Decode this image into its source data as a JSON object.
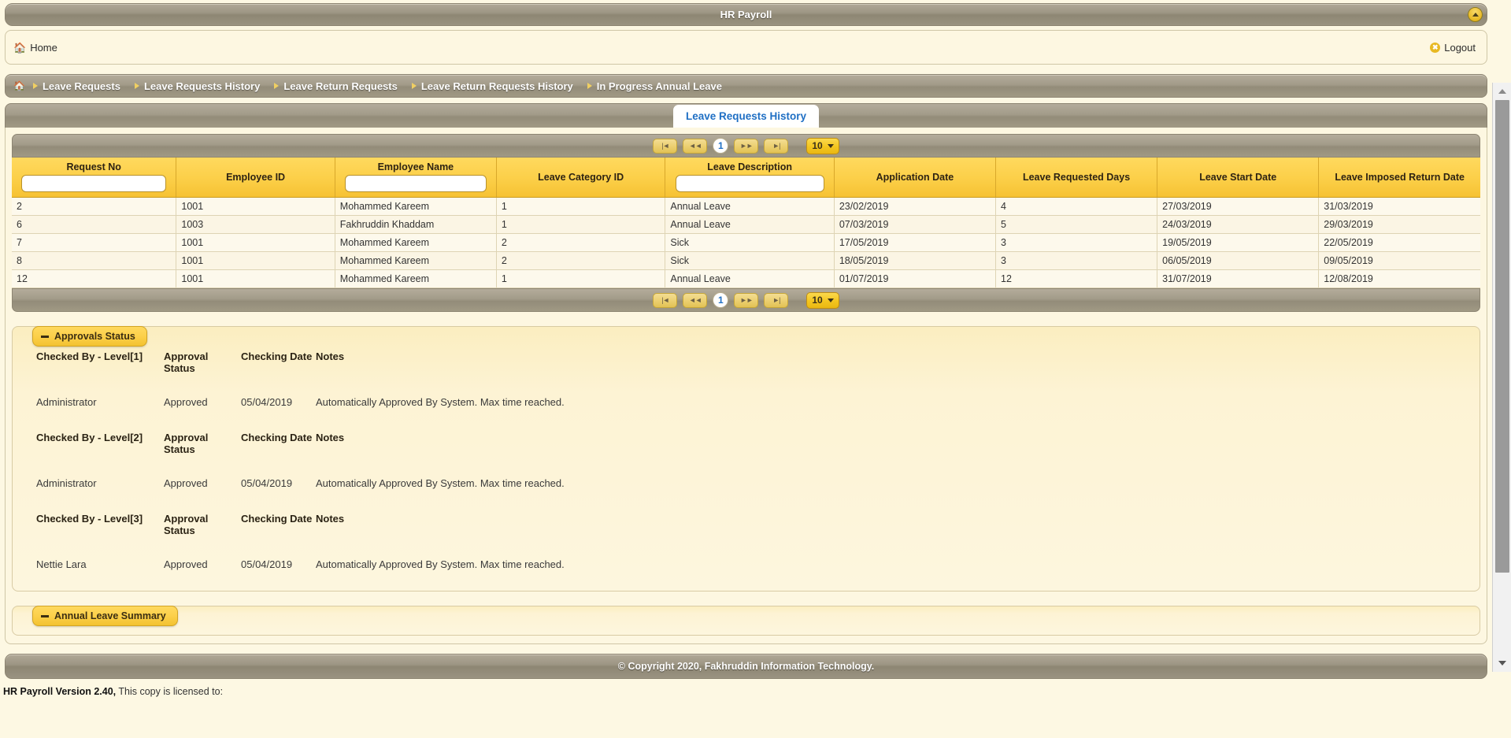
{
  "app": {
    "title": "HR Payroll",
    "collapse_icon": "collapse-up-icon"
  },
  "userbar": {
    "home_label": "Home",
    "home_icon": "home-icon",
    "logout_label": "Logout",
    "logout_icon": "close-circle-icon"
  },
  "menu": {
    "home_icon": "home-icon",
    "items": [
      {
        "label": "Leave Requests"
      },
      {
        "label": "Leave Requests History"
      },
      {
        "label": "Leave Return Requests"
      },
      {
        "label": "Leave Return Requests History"
      },
      {
        "label": "In Progress Annual Leave"
      }
    ]
  },
  "tabs": {
    "active": "Leave Requests History"
  },
  "pagination": {
    "first_icon": "first-page-icon",
    "prev_icon": "previous-page-icon",
    "next_icon": "next-page-icon",
    "last_icon": "last-page-icon",
    "first_label": "|◄",
    "prev_label": "◄◄",
    "next_label": "►►",
    "last_label": "►|",
    "current_page": "1",
    "page_size": "10"
  },
  "grid": {
    "columns": [
      {
        "label": "Request No",
        "filter": true,
        "value": ""
      },
      {
        "label": "Employee ID",
        "filter": false,
        "value": ""
      },
      {
        "label": "Employee Name",
        "filter": true,
        "value": ""
      },
      {
        "label": "Leave Category ID",
        "filter": false,
        "value": ""
      },
      {
        "label": "Leave Description",
        "filter": true,
        "value": ""
      },
      {
        "label": "Application Date",
        "filter": false,
        "value": ""
      },
      {
        "label": "Leave Requested Days",
        "filter": false,
        "value": ""
      },
      {
        "label": "Leave Start Date",
        "filter": false,
        "value": ""
      },
      {
        "label": "Leave Imposed Return Date",
        "filter": false,
        "value": ""
      }
    ],
    "rows": [
      [
        "2",
        "1001",
        "Mohammed Kareem",
        "1",
        "Annual Leave",
        "23/02/2019",
        "4",
        "27/03/2019",
        "31/03/2019"
      ],
      [
        "6",
        "1003",
        "Fakhruddin Khaddam",
        "1",
        "Annual Leave",
        "07/03/2019",
        "5",
        "24/03/2019",
        "29/03/2019"
      ],
      [
        "7",
        "1001",
        "Mohammed Kareem",
        "2",
        "Sick",
        "17/05/2019",
        "3",
        "19/05/2019",
        "22/05/2019"
      ],
      [
        "8",
        "1001",
        "Mohammed Kareem",
        "2",
        "Sick",
        "18/05/2019",
        "3",
        "06/05/2019",
        "09/05/2019"
      ],
      [
        "12",
        "1001",
        "Mohammed Kareem",
        "1",
        "Annual Leave",
        "01/07/2019",
        "12",
        "31/07/2019",
        "12/08/2019"
      ]
    ]
  },
  "approvals": {
    "section_title": "Approvals Status",
    "blocks": [
      {
        "headers": [
          "Checked By - Level[1]",
          "Approval Status",
          "Checking Date",
          "Notes"
        ],
        "values": [
          "Administrator",
          "Approved",
          "05/04/2019",
          "Automatically Approved By System. Max time reached."
        ]
      },
      {
        "headers": [
          "Checked By - Level[2]",
          "Approval Status",
          "Checking Date",
          "Notes"
        ],
        "values": [
          "Administrator",
          "Approved",
          "05/04/2019",
          "Automatically Approved By System. Max time reached."
        ]
      },
      {
        "headers": [
          "Checked By - Level[3]",
          "Approval Status",
          "Checking Date",
          "Notes"
        ],
        "values": [
          "Nettie Lara",
          "Approved",
          "05/04/2019",
          "Automatically Approved By System. Max time reached."
        ]
      }
    ]
  },
  "annual_summary": {
    "section_title": "Annual Leave Summary"
  },
  "footer": {
    "copyright": "© Copyright 2020, Fakhruddin Information Technology.",
    "version_label": "HR Payroll Version 2.40,",
    "license_text": " This copy is licensed to:"
  },
  "colors": {
    "accent_gold": "#f3c51f",
    "header_gold": "#fcd04a",
    "bar_taupe": "#9d9684",
    "panel_cream": "#fdf7e1",
    "tab_blue": "#1f6fc4"
  }
}
